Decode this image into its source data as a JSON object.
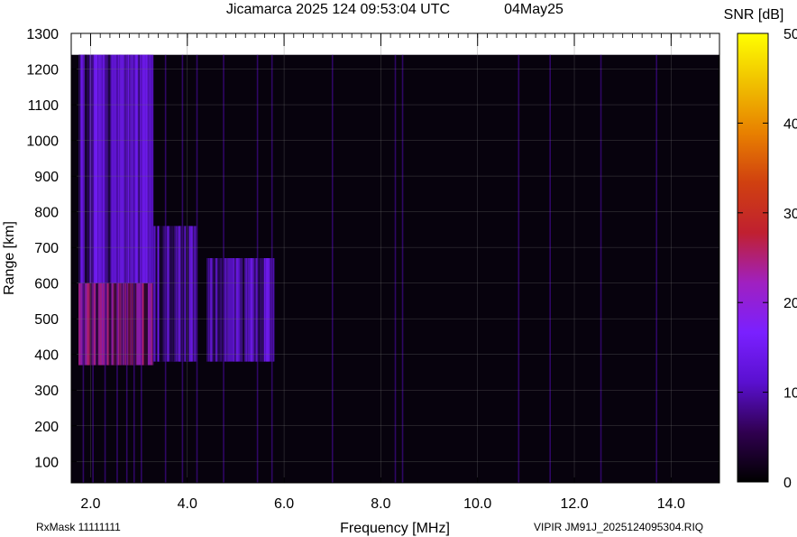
{
  "header": {
    "title": "Jicamarca 2025 124 09:53:04 UTC",
    "date": "04May25"
  },
  "footer": {
    "rx_mask": "RxMask 11111111",
    "filename": "VIPIR  JM91J_2025124095304.RIQ"
  },
  "colorbar": {
    "label": "SNR [dB]",
    "ticks": [
      0,
      10,
      20,
      30,
      40,
      50
    ],
    "range": [
      0,
      50
    ],
    "colors": [
      "#000000",
      "#300050",
      "#5a10d0",
      "#7a20ff",
      "#a020c0",
      "#c02030",
      "#d04010",
      "#e88000",
      "#f0c000",
      "#ffff00"
    ]
  },
  "chart_data": {
    "type": "heatmap",
    "xlabel": "Frequency [MHz]",
    "ylabel": "Range [km]",
    "xlim": [
      1.6,
      15.0
    ],
    "ylim": [
      40,
      1300
    ],
    "x_ticks": [
      2.0,
      4.0,
      6.0,
      8.0,
      10.0,
      12.0,
      14.0
    ],
    "y_ticks": [
      100,
      200,
      300,
      400,
      500,
      600,
      700,
      800,
      900,
      1000,
      1100,
      1200,
      1300
    ],
    "grid": true,
    "data_extent": {
      "x": [
        1.6,
        15.0
      ],
      "y": [
        40,
        1240
      ]
    },
    "regions": [
      {
        "name": "o-trace-lower",
        "x": [
          1.75,
          3.3
        ],
        "y": [
          370,
          600
        ],
        "snr_db": 22
      },
      {
        "name": "o-trace-spread",
        "x": [
          1.75,
          3.3
        ],
        "y": [
          600,
          1240
        ],
        "snr_db": 12
      },
      {
        "name": "diffuse-mid",
        "x": [
          3.3,
          4.2
        ],
        "y": [
          380,
          760
        ],
        "snr_db": 12
      },
      {
        "name": "x-trace",
        "x": [
          4.4,
          5.8
        ],
        "y": [
          380,
          670
        ],
        "snr_db": 12
      }
    ],
    "interference_lines_mhz": [
      1.85,
      2.05,
      2.3,
      2.55,
      2.75,
      2.9,
      3.05,
      3.55,
      3.9,
      4.2,
      4.75,
      5.45,
      5.75,
      7.0,
      8.3,
      8.45,
      10.85,
      11.5,
      12.55,
      13.7
    ]
  }
}
